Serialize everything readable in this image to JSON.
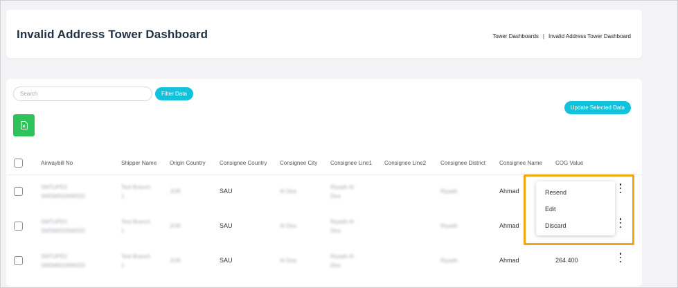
{
  "header": {
    "title": "Invalid Address Tower Dashboard",
    "breadcrumb": [
      "Tower Dashboards",
      "Invalid Address Tower Dashboard"
    ],
    "breadcrumb_separator": "|"
  },
  "toolbar": {
    "search_placeholder": "Search",
    "filter_label": "Filter Data",
    "update_label": "Update Selected Data",
    "excel_icon": "excel-export-icon"
  },
  "table": {
    "columns": [
      "Airwaybill No",
      "Shipper Name",
      "Origin Country",
      "Consignee Country",
      "Consignee City",
      "Consignee Line1",
      "Consignee Line2",
      "Consignee District",
      "Consignee Name",
      "COG Value"
    ],
    "rows": [
      {
        "awb": [
          "SMTUPE0",
          "SMSM0026W02D"
        ],
        "shipper": [
          "Test Branch",
          "1"
        ],
        "origin": "JOR",
        "country": "SAU",
        "city": "Al Dira",
        "line1": [
          "Riyadh Al",
          "Dira"
        ],
        "line2": "",
        "district": "Riyadh",
        "name": "Ahmad",
        "cog": ""
      },
      {
        "awb": [
          "SMTUPE0",
          "SMSM0026W02D"
        ],
        "shipper": [
          "Test Branch",
          "1"
        ],
        "origin": "JOR",
        "country": "SAU",
        "city": "Al Dira",
        "line1": [
          "Riyadh Al",
          "Dira"
        ],
        "line2": "",
        "district": "Riyadh",
        "name": "Ahmad",
        "cog": ""
      },
      {
        "awb": [
          "SMTUPE0",
          "SMSM0026W02D"
        ],
        "shipper": [
          "Test Branch",
          "1"
        ],
        "origin": "JOR",
        "country": "SAU",
        "city": "Al Dira",
        "line1": [
          "Riyadh Al",
          "Dira"
        ],
        "line2": "",
        "district": "Riyadh",
        "name": "Ahmad",
        "cog": "264.400"
      }
    ]
  },
  "row_menu": {
    "items": [
      "Resend",
      "Edit",
      "Discard"
    ]
  },
  "colors": {
    "accent": "#12c1dc",
    "excel": "#2dc25a",
    "highlight": "#f2a711"
  }
}
